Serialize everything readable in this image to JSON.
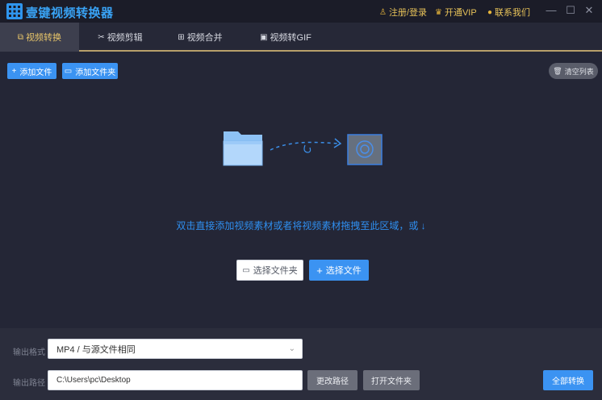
{
  "titlebar": {
    "app_title": "壹键视频转换器",
    "register_login": "注册/登录",
    "vip": "开通VIP",
    "contact": "联系我们"
  },
  "tabs": [
    {
      "label": "视频转换",
      "icon": "convert-icon",
      "active": true
    },
    {
      "label": "视频剪辑",
      "icon": "scissors-icon",
      "active": false
    },
    {
      "label": "视频合并",
      "icon": "merge-icon",
      "active": false
    },
    {
      "label": "视频转GIF",
      "icon": "gif-icon",
      "active": false
    }
  ],
  "toolbar": {
    "add_file": "添加文件",
    "add_folder": "添加文件夹",
    "clear_list": "清空列表"
  },
  "dropzone": {
    "hint": "双击直接添加视频素材或者将视频素材拖拽至此区域，或 ↓",
    "choose_folder": "选择文件夹",
    "choose_file": "选择文件"
  },
  "output": {
    "format_label": "输出格式",
    "format_value": "MP4 / 与源文件相同",
    "path_label": "输出路径",
    "path_value": "C:\\Users\\pc\\Desktop",
    "change_path": "更改路径",
    "open_folder": "打开文件夹",
    "convert_all": "全部转换"
  },
  "colors": {
    "accent_blue": "#3b93f2",
    "accent_gold": "#e9c66a",
    "background": "#242636"
  }
}
